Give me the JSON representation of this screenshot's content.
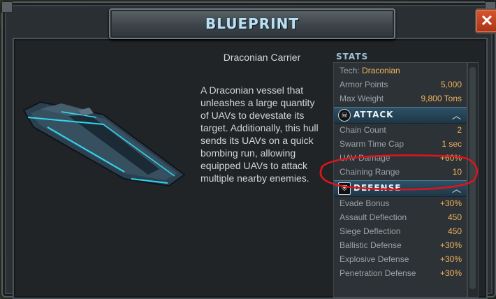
{
  "dialog": {
    "title": "BLUEPRINT",
    "close_label": "✕"
  },
  "ship": {
    "name": "Draconian Carrier",
    "description": "A Draconian vessel that unleashes a large quantity of UAVs to devestate its target. Additionally, this hull sends its UAVs on a quick bombing run, allowing equipped UAVs to attack multiple nearby enemies."
  },
  "stats": {
    "header": "STATS",
    "tech_label": "Tech:",
    "tech_value": "Draconian",
    "base": [
      {
        "label": "Armor Points",
        "value": "5,000"
      },
      {
        "label": "Max Weight",
        "value": "9,800 Tons"
      }
    ],
    "attack": {
      "title": "ATTACK",
      "icon": "skull-icon",
      "rows": [
        {
          "label": "Chain Count",
          "value": "2"
        },
        {
          "label": "Swarm Time Cap",
          "value": "1 sec"
        },
        {
          "label": "UAV Damage",
          "value": "+60%"
        },
        {
          "label": "Chaining Range",
          "value": "10"
        }
      ]
    },
    "defense": {
      "title": "DEFENSE",
      "icon": "shield-icon",
      "rows": [
        {
          "label": "Evade Bonus",
          "value": "+30%"
        },
        {
          "label": "Assault Deflection",
          "value": "450"
        },
        {
          "label": "Siege Deflection",
          "value": "450"
        },
        {
          "label": "Ballistic Defense",
          "value": "+30%"
        },
        {
          "label": "Explosive Defense",
          "value": "+30%"
        },
        {
          "label": "Penetration Defense",
          "value": "+30%"
        }
      ]
    }
  },
  "colors": {
    "accent": "#f2b45c",
    "title": "#bfe0f2",
    "annotation": "#e0141c"
  }
}
